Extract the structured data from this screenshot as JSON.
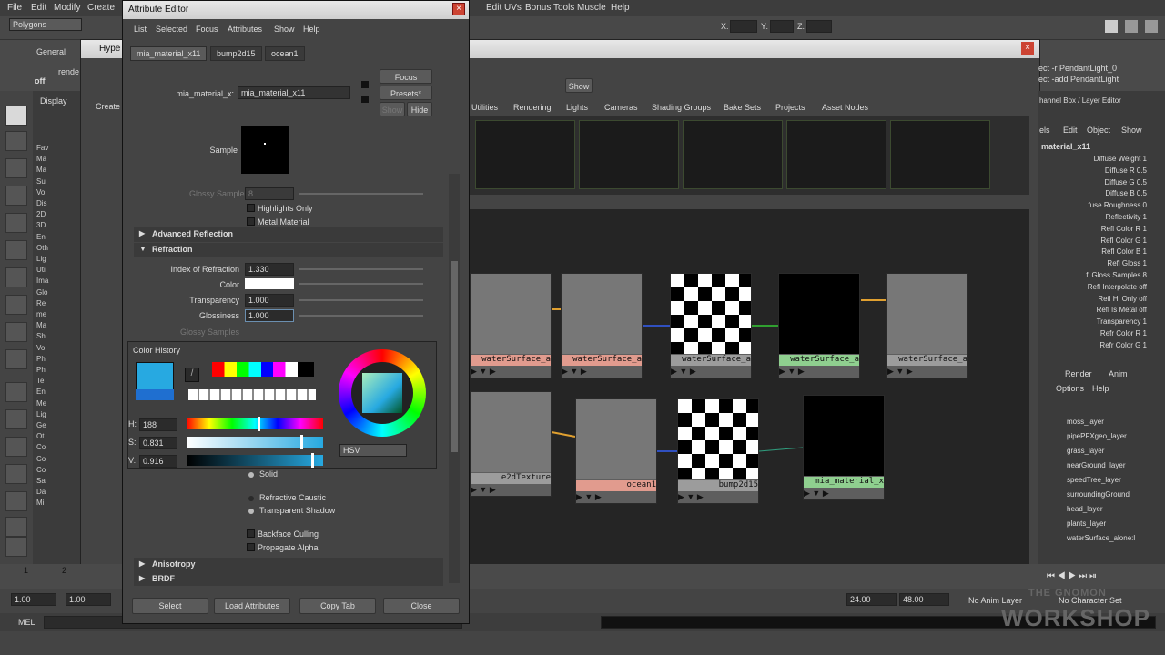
{
  "menubar": [
    "File",
    "Edit",
    "Modify",
    "Create"
  ],
  "menubar_right": [
    "Edit UVs",
    "Bonus Tools",
    "Muscle",
    "Help"
  ],
  "mode_select": "Polygons",
  "coords": {
    "x": "X:",
    "y": "Y:",
    "z": "Z:"
  },
  "shelf": {
    "tab": "General",
    "render_label": "rende",
    "off_label": "off"
  },
  "outliner": {
    "display": "Display",
    "rows": [
      "Fav",
      "Ma",
      "Ma",
      "Su",
      "Vo",
      "Dis",
      "2D",
      "3D",
      "En",
      "Oth",
      "Lig",
      "Uti",
      "Ima",
      "Glo",
      "Re",
      "me",
      "Ma",
      "Sh",
      "Vo",
      "Ph",
      "Ph",
      "Te",
      "En",
      "Me",
      "Lig",
      "Ge",
      "Ot",
      "Co",
      "Co",
      "Co",
      "Sa",
      "Da",
      "Mi"
    ]
  },
  "hypershade": {
    "title": "Hype",
    "create_label": "Create",
    "script_lines": [
      "ect -r PendantLight_0",
      "ect -add PendantLight"
    ],
    "show_btn": "Show",
    "tabs": [
      "Utilities",
      "Rendering",
      "Lights",
      "Cameras",
      "Shading Groups",
      "Bake Sets",
      "Projects",
      "Asset Nodes"
    ],
    "nodes": [
      {
        "label": "waterSurface_a",
        "color": "#e19b8e"
      },
      {
        "label": "waterSurface_a",
        "color": "#e19b8e"
      },
      {
        "label": "waterSurface_a",
        "color": "#9c9c9c"
      },
      {
        "label": "waterSurface_a",
        "color": "#8fcf8f"
      },
      {
        "label": "waterSurface_a",
        "color": "#9c9c9c"
      },
      {
        "label": "e2dTexture",
        "color": "#9c9c9c"
      },
      {
        "label": "ocean1",
        "color": "#e19b8e"
      },
      {
        "label": "bump2d15",
        "color": "#9c9c9c"
      },
      {
        "label": "mia_material_x",
        "color": "#8fcf8f"
      }
    ]
  },
  "channel_box": {
    "title": "hannel Box / Layer Editor",
    "menus": [
      "els",
      "Edit",
      "Object",
      "Show"
    ],
    "object": "material_x11",
    "rows": [
      "Diffuse Weight 1",
      "Diffuse R 0.5",
      "Diffuse G 0.5",
      "Diffuse B 0.5",
      "fuse Roughness 0",
      "Reflectivity 1",
      "Refl Color R 1",
      "Refl Color G 1",
      "Refl Color B 1",
      "Refl Gloss 1",
      "fl Gloss Samples 8",
      "Refl Interpolate off",
      "Refl Hl Only off",
      "Refl Is Metal off",
      "Transparency 1",
      "Refr Color R 1",
      "Refr Color G 1"
    ]
  },
  "layer_editor": {
    "tabs": [
      "Render",
      "Anim"
    ],
    "menus": [
      "Options",
      "Help"
    ],
    "layers": [
      "moss_layer",
      "pipePFXgeo_layer",
      "grass_layer",
      "nearGround_layer",
      "speedTree_layer",
      "surroundingGround",
      "head_layer",
      "plants_layer",
      "waterSurface_alone:l"
    ]
  },
  "timeline": {
    "start": "1",
    "two": "2",
    "f1": "1.00",
    "f2": "1.00",
    "end1": "24.00",
    "end2": "48.00",
    "anim_layer": "No Anim Layer",
    "char_set": "No Character Set",
    "mel": "MEL"
  },
  "ae": {
    "title": "Attribute Editor",
    "menu": [
      "List",
      "Selected",
      "Focus",
      "Attributes",
      "Show",
      "Help"
    ],
    "tabs": [
      "mia_material_x11",
      "bump2d15",
      "ocean1"
    ],
    "node_label": "mia_material_x:",
    "node_value": "mia_material_x11",
    "focus_btn": "Focus",
    "presets_btn": "Presets*",
    "show_btn": "Show",
    "hide_btn": "Hide",
    "sample_label": "Sample",
    "glossy_samples": "Glossy Samples",
    "glossy_value": "8",
    "highlights_only": "Highlights Only",
    "metal_material": "Metal Material",
    "advanced_reflection": "Advanced Reflection",
    "refraction": "Refraction",
    "ior_label": "Index of Refraction",
    "ior_value": "1.330",
    "color_label": "Color",
    "transparency_label": "Transparency",
    "transparency_value": "1.000",
    "glossiness_label": "Glossiness",
    "glossiness_value": "1.000",
    "glossy_samples2": "Glossy Samples",
    "solid": "Solid",
    "refractive_caustic": "Refractive Caustic",
    "transparent_shadow": "Transparent Shadow",
    "backface_culling": "Backface Culling",
    "propagate_alpha": "Propagate Alpha",
    "anisotropy": "Anisotropy",
    "brdf": "BRDF",
    "buttons": [
      "Select",
      "Load Attributes",
      "Copy Tab",
      "Close"
    ]
  },
  "color_picker": {
    "title": "Color History",
    "h_label": "H:",
    "h_value": "188",
    "s_label": "S:",
    "s_value": "0.831",
    "v_label": "V:",
    "v_value": "0.916",
    "mode": "HSV",
    "hue_fraction": 0.52,
    "sat_fraction": 0.831,
    "val_fraction": 0.916,
    "swatch_color": "#27a9e1"
  },
  "watermark": {
    "line1": "THE GNOMON",
    "line2": "WORKSHOP"
  }
}
